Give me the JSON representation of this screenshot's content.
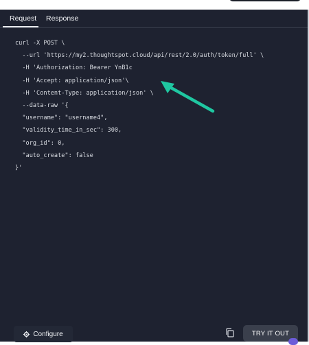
{
  "tabs": {
    "request": "Request",
    "response": "Response"
  },
  "code": {
    "lines": [
      "curl -X POST \\",
      "  --url 'https://my2.thoughtspot.cloud/api/rest/2.0/auth/token/full' \\",
      "  -H 'Authorization: Bearer YnB1c",
      "  -H 'Accept: application/json'\\",
      "  -H 'Content-Type: application/json' \\",
      "  --data-raw '{",
      "  \"username\": \"username4\",",
      "  \"validity_time_in_sec\": 300,",
      "  \"org_id\": 0,",
      "  \"auto_create\": false",
      "}'"
    ]
  },
  "footer": {
    "configure_label": "Configure",
    "try_label": "TRY IT OUT"
  },
  "icons": {
    "configure": "gear-icon",
    "copy": "copy-icon",
    "annotation": "arrow-icon"
  },
  "colors": {
    "panel_bg": "#1e2230",
    "annotation_arrow": "#1fc7a1",
    "button_bg": "#3a3f4c"
  }
}
